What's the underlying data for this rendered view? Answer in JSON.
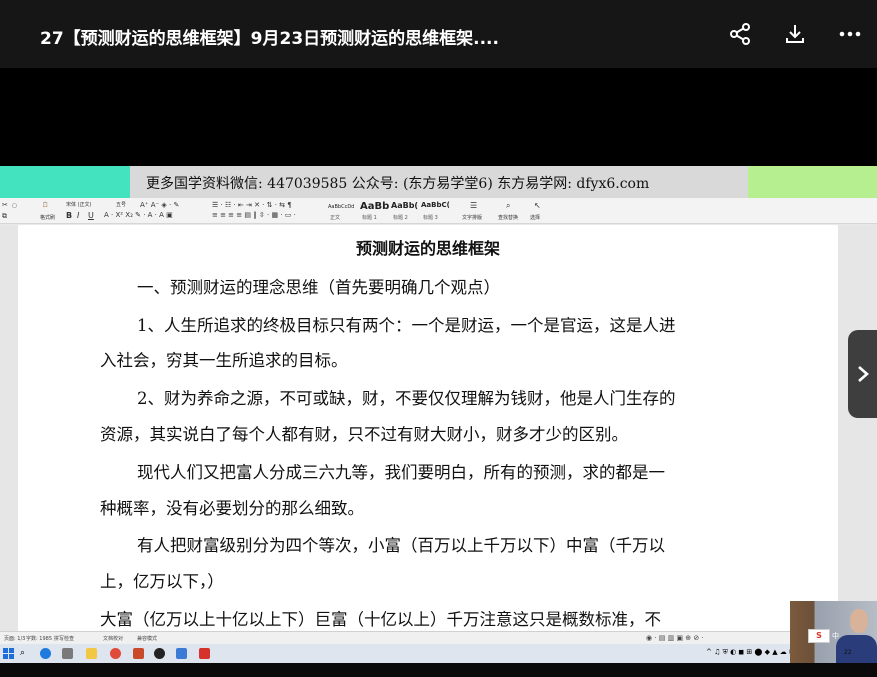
{
  "header": {
    "title": "27【预测财运的思维框架】9月23日预测财运的思维框架....",
    "share_icon": "share-icon",
    "download_icon": "download-icon",
    "more_icon": "more-icon"
  },
  "banner": {
    "text": "更多国学资料微信: 447039585 公众号: (东方易学堂6) 东方易学网: dfyx6.com"
  },
  "ribbon": {
    "format_painter": "格式刷",
    "font_name": "宋体 (正文)",
    "font_size": "五号",
    "styles": [
      {
        "preview": "AaBbCcDd",
        "label": "正文"
      },
      {
        "preview": "AaBb",
        "label": "标题 1"
      },
      {
        "preview": "AaBb(",
        "label": "标题 2"
      },
      {
        "preview": "AaBbC(",
        "label": "标题 3"
      }
    ],
    "text_tools": "文字排版",
    "find_replace": "查找替换",
    "select": "选择"
  },
  "document": {
    "title": "预测财运的思维框架",
    "lines": [
      "一、预测财运的理念思维（首先要明确几个观点）",
      "1、人生所追求的终极目标只有两个：一个是财运，一个是官运，这是人进",
      "入社会，穷其一生所追求的目标。",
      "2、财为养命之源，不可或缺，财，不要仅仅理解为钱财，他是人门生存的",
      "资源，其实说白了每个人都有财，只不过有财大财小，财多才少的区别。",
      "现代人们又把富人分成三六九等，我们要明白，所有的预测，求的都是一",
      "种概率，没有必要划分的那么细致。",
      "有人把财富级别分为四个等次，小富（百万以上千万以下）中富（千万以",
      "上，亿万以下，）",
      "大富（亿万以上十亿以上下）巨富（十亿以上）千万注意这只是概数标准，不"
    ]
  },
  "statusbar": {
    "page": "页面: 1/3",
    "words": "字数: 1985",
    "spell": "拼写检查",
    "doc_check": "文档校对",
    "compat": "兼容模式"
  },
  "tray": {
    "ime": "中",
    "time": "22"
  },
  "colors": {
    "topbar": "#161616",
    "banner_left": "#43e3c0",
    "banner_right": "#b6ef8f"
  }
}
